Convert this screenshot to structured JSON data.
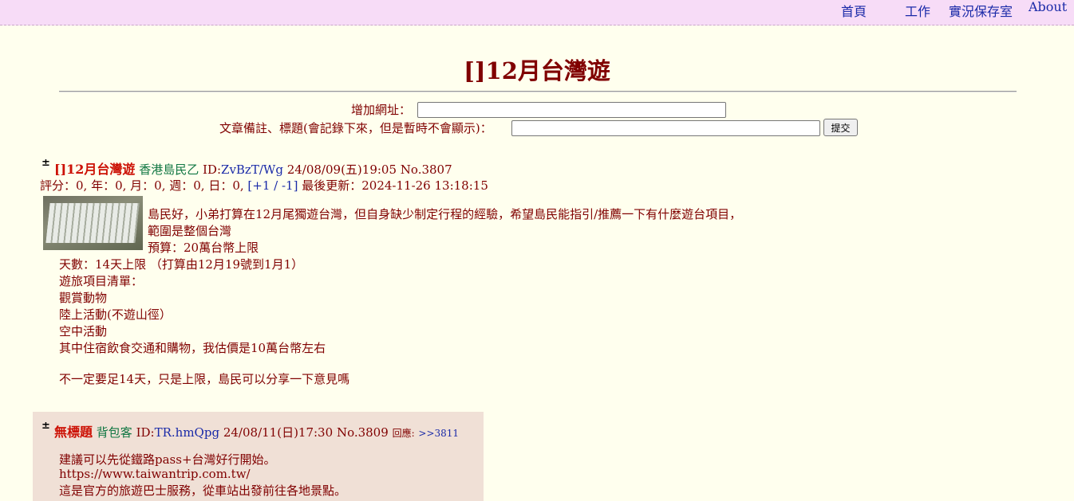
{
  "nav": {
    "home": "首頁",
    "work": "工作",
    "archive": "實況保存室",
    "about": "About"
  },
  "page": {
    "title": "[]12月台灣遊"
  },
  "form": {
    "url_label": "增加網址：",
    "url_value": "",
    "note_label": "文章備註、標題(會記錄下來，但是暫時不會顯示)：",
    "note_value": "",
    "submit_label": "提交"
  },
  "posts": [
    {
      "toggle": "±",
      "subject": "[]12月台灣遊",
      "name": "香港島民乙",
      "id_prefix": "ID:",
      "id": "ZvBzT/Wg",
      "datetime": "24/08/09(五)19:05",
      "number": "No.3807",
      "rating_line_prefix": "評分：0, 年：0, 月：0, 週：0, 日：0, ",
      "vote_open": "[",
      "vote_plus": "+1",
      "vote_sep": " / ",
      "vote_minus": "-1",
      "vote_close": "]",
      "updated": " 最後更新：2024-11-26 13:18:15",
      "body": [
        "島民好，小弟打算在12月尾獨遊台灣，但自身缺少制定行程的經驗，希望島民能指引/推薦一下有什麼遊台項目，",
        "範圍是整個台灣",
        "預算：20萬台幣上限",
        "天數：14天上限 （打算由12月19號到1月1）",
        "遊旅項目清單：",
        "觀賞動物",
        "陸上活動(不遊山徑）",
        "空中活動",
        "其中住宿飲食交通和購物，我估價是10萬台幣左右",
        "不一定要足14天，只是上限，島民可以分享一下意見嗎"
      ]
    },
    {
      "toggle": "±",
      "subject": "無標題",
      "name": "背包客",
      "id_prefix": "ID:",
      "id": "TR.hmQpg",
      "datetime": "24/08/11(日)17:30",
      "number": "No.3809",
      "reply_label": "回應:",
      "reply_link": ">>3811",
      "body": [
        "建議可以先從鐵路pass+台灣好行開始。",
        "https://www.taiwantrip.com.tw/",
        "這是官方的旅遊巴士服務，從車站出發前往各地景點。"
      ]
    }
  ]
}
